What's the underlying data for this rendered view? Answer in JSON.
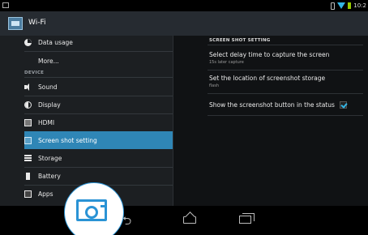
{
  "status_bar": {
    "time": "10:2"
  },
  "action_bar": {
    "title": "Wi-Fi"
  },
  "left_menu": {
    "top_items": [
      {
        "label": "Data usage",
        "icon": "data-usage-icon"
      },
      {
        "label": "More...",
        "icon": ""
      }
    ],
    "section_device": "DEVICE",
    "device_items": [
      {
        "label": "Sound",
        "icon": "sound-icon"
      },
      {
        "label": "Display",
        "icon": "display-icon"
      },
      {
        "label": "HDMI",
        "icon": "hdmi-icon"
      },
      {
        "label": "Screen shot setting",
        "icon": "screenshot-icon",
        "selected": true
      },
      {
        "label": "Storage",
        "icon": "storage-icon"
      },
      {
        "label": "Battery",
        "icon": "battery-icon"
      },
      {
        "label": "Apps",
        "icon": "apps-icon"
      }
    ]
  },
  "right_panel": {
    "header": "SCREEN SHOT SETTING",
    "settings": [
      {
        "title": "Select delay time to capture the screen",
        "subtitle": "15s later capture"
      },
      {
        "title": "Set the location of screenshot storage",
        "subtitle": "flash"
      },
      {
        "title": "Show the screenshot button in the status",
        "checked": true
      }
    ]
  },
  "nav_bar": {
    "back": "⮌",
    "home": "home",
    "recent": "recent-apps"
  },
  "callout": {
    "icon": "camera-icon"
  },
  "colors": {
    "accent": "#33b5e5",
    "selected_row": "#2f86b6",
    "callout_blue": "#2a93d5"
  }
}
